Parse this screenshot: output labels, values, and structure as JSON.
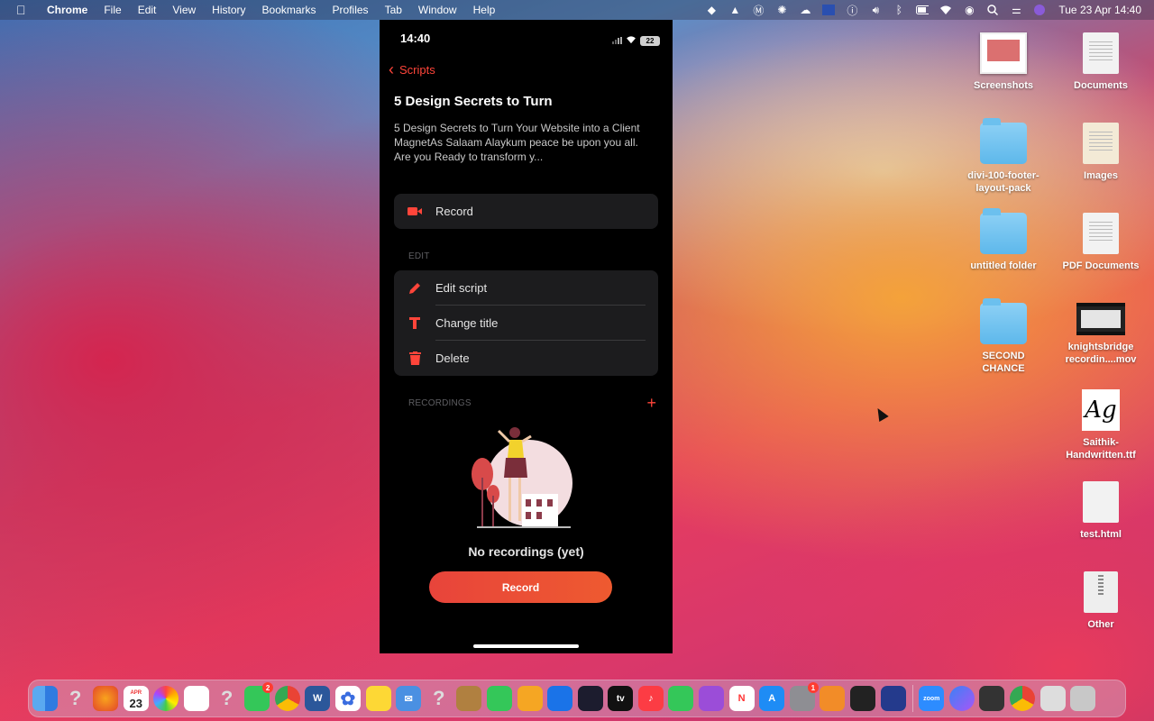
{
  "menubar": {
    "app_name": "Chrome",
    "menus": [
      "File",
      "Edit",
      "View",
      "History",
      "Bookmarks",
      "Profiles",
      "Tab",
      "Window",
      "Help"
    ],
    "clock": "Tue 23 Apr  14:40"
  },
  "phone": {
    "status_time": "14:40",
    "battery": "22",
    "back_label": "Scripts",
    "title": "5 Design Secrets to Turn",
    "description": "5 Design Secrets to Turn Your Website into a Client MagnetAs Salaam Alaykum peace be upon you all. Are you Ready to transform y...",
    "record_row_label": "Record",
    "edit_section_label": "EDIT",
    "edit_items": [
      {
        "label": "Edit script",
        "icon": "pencil-icon"
      },
      {
        "label": "Change title",
        "icon": "title-t-icon"
      },
      {
        "label": "Delete",
        "icon": "trash-icon"
      }
    ],
    "recordings_section_label": "RECORDINGS",
    "add_recording": "+",
    "empty_state_text": "No recordings (yet)",
    "record_button_label": "Record",
    "accent_color": "#ff453a"
  },
  "desktop": {
    "icons": [
      {
        "label": "Screenshots"
      },
      {
        "label": "Documents"
      },
      {
        "label": "divi-100-footer-layout-pack"
      },
      {
        "label": "Images"
      },
      {
        "label": "untitled folder"
      },
      {
        "label": "PDF Documents"
      },
      {
        "label": "SECOND CHANCE"
      },
      {
        "label": "knightsbridge recordin....mov"
      },
      {
        "label": "Saithik-Handwritten.ttf"
      },
      {
        "label": "test.html"
      },
      {
        "label": "Other"
      }
    ],
    "calendar_month": "APR",
    "calendar_day": "23",
    "font_preview": "Ag",
    "zoom_label": "zoom"
  },
  "dock": {
    "badges": {
      "facetime": "2",
      "system_prefs": "1"
    }
  }
}
